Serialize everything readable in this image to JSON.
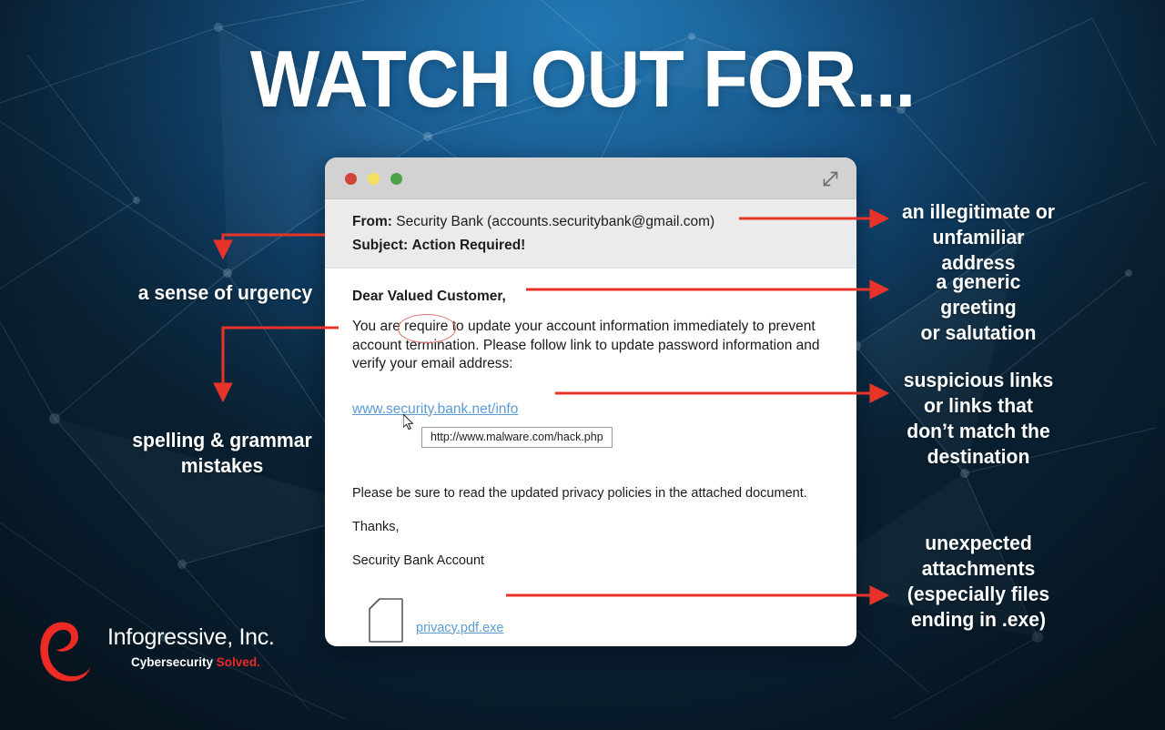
{
  "title": "WATCH OUT FOR...",
  "colors": {
    "accent_red": "#e8332a",
    "link_blue": "#5b9bd5",
    "bg_dark": "#0c2c45",
    "bg_light": "#2279b4",
    "logo_red": "#ee2a24"
  },
  "window": {
    "traffic_lights": [
      "close-red",
      "minimize-yellow",
      "maximize-green"
    ],
    "expand_icon": "expand-diagonal-icon"
  },
  "email": {
    "from_label": "From:",
    "from_value": "Security Bank (accounts.securitybank@gmail.com)",
    "subject_label": "Subject:",
    "subject_value": "Action Required!",
    "greeting": "Dear Valued Customer,",
    "body_part1": "You are ",
    "body_misspelling": "require",
    "body_part2": " to update your account information immediately to prevent account termination. Please follow link to update password information and verify your email address:",
    "link_text": "www.security.bank.net/info",
    "link_tooltip": "http://www.malware.com/hack.php",
    "closing_line1": "Please be sure to read the updated privacy policies in the attached document.",
    "closing_line2": "Thanks,",
    "closing_line3": "Security Bank Account",
    "attachment_name": "privacy.pdf.exe",
    "attachment_icon": "document-icon",
    "cursor_icon": "mouse-pointer-icon"
  },
  "annotations": {
    "left": [
      {
        "id": "urgency",
        "text": "a sense of urgency"
      },
      {
        "id": "spelling",
        "line1": "spelling & grammar",
        "line2": "mistakes"
      }
    ],
    "right": [
      {
        "id": "address",
        "line1": "an illegitimate or",
        "line2": "unfamiliar address"
      },
      {
        "id": "greeting",
        "line1": "a generic greeting",
        "line2": "or salutation"
      },
      {
        "id": "links",
        "line1": "suspicious links",
        "line2": "or links that",
        "line3": "don’t match the",
        "line4": "destination"
      },
      {
        "id": "attachments",
        "line1": "unexpected",
        "line2": "attachments",
        "line3": "(especially files",
        "line4": "ending in .exe)"
      }
    ]
  },
  "logo": {
    "mark": "infogressive-e-logo",
    "name": "Infogressive, Inc.",
    "tagline_plain": "Cybersecurity ",
    "tagline_accent": "Solved."
  }
}
